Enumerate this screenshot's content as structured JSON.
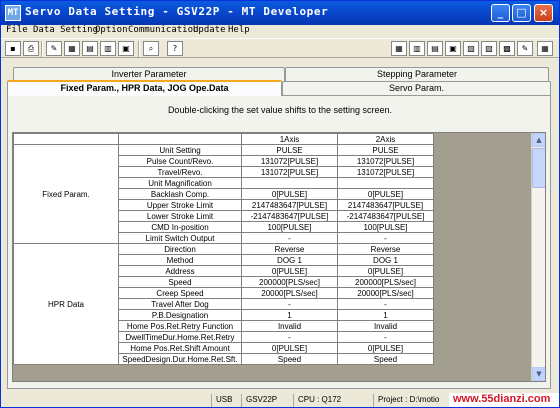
{
  "window": {
    "title": "Servo Data Setting - GSV22P - MT Developer",
    "icon_label": "MT"
  },
  "caption_buttons": {
    "minimize": "_",
    "maximize": "□",
    "close": "×"
  },
  "menu": [
    "File",
    "Data Setting",
    "Option",
    "Communication",
    "Update",
    "Help"
  ],
  "toolbar_left": [
    "save-icon",
    "print-icon",
    "tool-icon",
    "calc-icon",
    "edit-icon",
    "table-icon",
    "monitor-icon",
    "help-icon"
  ],
  "toolbar_right": [
    "axis-icon",
    "servo-icon",
    "amp-icon",
    "fixed-param-icon",
    "hpr-icon",
    "jog-icon",
    "window-icon",
    "pen-icon",
    "tile-icon"
  ],
  "tabs": {
    "inverter": "Inverter Parameter",
    "stepping": "Stepping Parameter",
    "fixed": "Fixed Param., HPR Data, JOG Ope.Data",
    "servo": "Servo Param."
  },
  "hint": "Double-clicking the set value shifts to the setting screen.",
  "grid": {
    "axes": [
      "1Axis",
      "2Axis"
    ],
    "groups": [
      {
        "name": "Fixed Param.",
        "rows": [
          {
            "label": "Unit Setting",
            "v1": "PULSE",
            "v2": "PULSE"
          },
          {
            "label": "Pulse Count/Revo.",
            "v1": "131072[PULSE]",
            "v2": "131072[PULSE]"
          },
          {
            "label": "Travel/Revo.",
            "v1": "131072[PULSE]",
            "v2": "131072[PULSE]"
          },
          {
            "label": "Unit Magnification",
            "v1": "",
            "v2": ""
          },
          {
            "label": "Backlash Comp.",
            "v1": "0[PULSE]",
            "v2": "0[PULSE]"
          },
          {
            "label": "Upper Stroke Limit",
            "v1": "2147483647[PULSE]",
            "v2": "2147483647[PULSE]"
          },
          {
            "label": "Lower Stroke Limit",
            "v1": "-2147483647[PULSE]",
            "v2": "-2147483647[PULSE]"
          },
          {
            "label": "CMD In-position",
            "v1": "100[PULSE]",
            "v2": "100[PULSE]"
          },
          {
            "label": "Limit Switch Output",
            "v1": "-",
            "v2": "-"
          }
        ]
      },
      {
        "name": "HPR Data",
        "rows": [
          {
            "label": "Direction",
            "v1": "Reverse",
            "v2": "Reverse"
          },
          {
            "label": "Method",
            "v1": "DOG 1",
            "v2": "DOG 1"
          },
          {
            "label": "Address",
            "v1": "0[PULSE]",
            "v2": "0[PULSE]"
          },
          {
            "label": "Speed",
            "v1": "200000[PLS/sec]",
            "v2": "200000[PLS/sec]"
          },
          {
            "label": "Creep Speed",
            "v1": "20000[PLS/sec]",
            "v2": "20000[PLS/sec]"
          },
          {
            "label": "Travel After Dog",
            "v1": "-",
            "v2": "-"
          },
          {
            "label": "P.B.Designation",
            "v1": "1",
            "v2": "1"
          },
          {
            "label": "Home Pos.Ret.Retry Function",
            "v1": "Invalid",
            "v2": "Invalid"
          },
          {
            "label": "DwellTimeDur.Home.Ret.Retry",
            "v1": "-",
            "v2": "-"
          },
          {
            "label": "Home Pos.Ret.Shift Amount",
            "v1": "0[PULSE]",
            "v2": "0[PULSE]"
          },
          {
            "label": "SpeedDesign.Dur.Home.Ret.Sft.",
            "v1": "Speed",
            "v2": "Speed"
          }
        ]
      }
    ]
  },
  "scrollbar": {
    "up": "▲",
    "down": "▼"
  },
  "status": {
    "conn": "USB",
    "model": "GSV22P",
    "cpu": "CPU : Q172",
    "project": "Project : D:\\motio"
  },
  "watermark": "www.55dianzi.com"
}
